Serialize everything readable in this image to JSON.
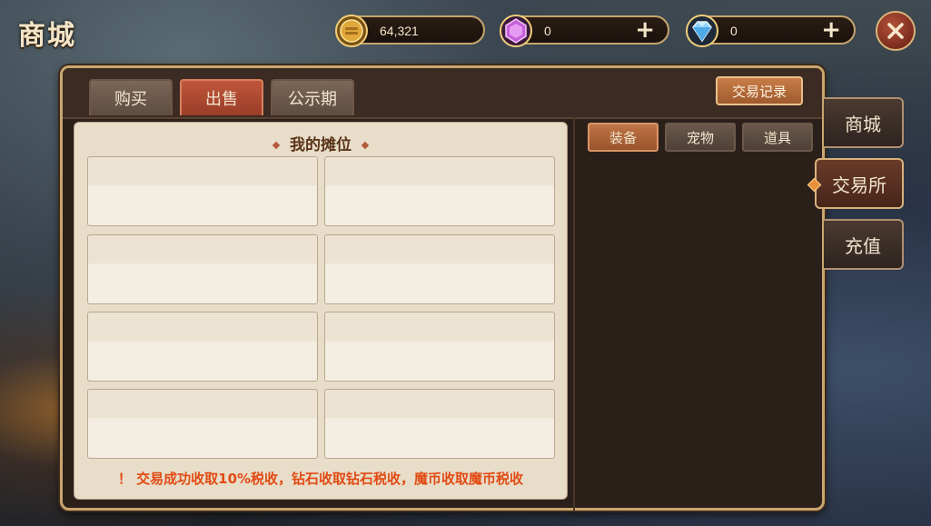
{
  "header": {
    "title": "商城",
    "currencies": {
      "coin": {
        "value": "64,321",
        "icon": "gold-coin-icon"
      },
      "gem": {
        "value": "0",
        "plus": "+",
        "icon": "purple-gem-icon"
      },
      "diamond": {
        "value": "0",
        "plus": "+",
        "icon": "diamond-icon"
      }
    },
    "close_symbol": "✕"
  },
  "tabs": [
    {
      "label": "购买",
      "active": false
    },
    {
      "label": "出售",
      "active": true
    },
    {
      "label": "公示期",
      "active": false
    }
  ],
  "record_button": "交易记录",
  "stall": {
    "title": "我的摊位",
    "tax_note": "！ 交易成功收取10%税收，钻石收取钻石税收，魔币收取魔币税收"
  },
  "subtabs": [
    {
      "label": "装备",
      "active": true
    },
    {
      "label": "宠物",
      "active": false
    },
    {
      "label": "道具",
      "active": false
    }
  ],
  "side_nav": [
    {
      "label": "商城",
      "active": false
    },
    {
      "label": "交易所",
      "active": true
    },
    {
      "label": "充值",
      "active": false
    }
  ],
  "colors": {
    "accent_active_tab": "#b04a30",
    "tax_note": "#e24a13",
    "panel_border": "#c9a66f"
  }
}
